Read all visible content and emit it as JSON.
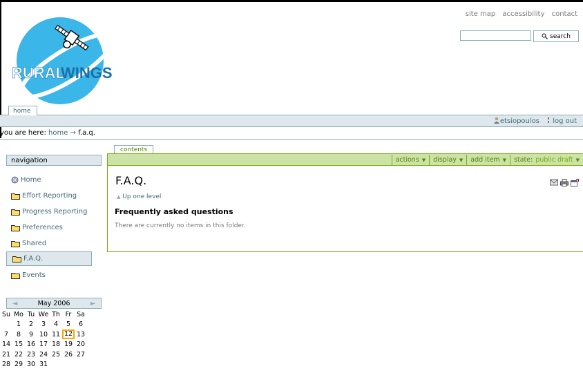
{
  "site_actions": [
    "site map",
    "accessibility",
    "contact"
  ],
  "search": {
    "value": "",
    "button_label": "search"
  },
  "logo": {
    "text_part1": "RURAL",
    "text_part2": "WINGS"
  },
  "tabs": {
    "home": "home"
  },
  "personal_bar": {
    "user": "etsiopoulos",
    "logout": "log out"
  },
  "breadcrumb": {
    "prefix": "you are here:",
    "home": "home",
    "arrow": "→",
    "current": "f.a.q."
  },
  "navigation": {
    "title": "navigation",
    "items": [
      {
        "label": "Home",
        "icon": "globe-icon"
      },
      {
        "label": "Effort Reporting",
        "icon": "folder-icon"
      },
      {
        "label": "Progress Reporting",
        "icon": "folder-icon"
      },
      {
        "label": "Preferences",
        "icon": "folder-icon"
      },
      {
        "label": "Shared",
        "icon": "folder-icon"
      },
      {
        "label": "F.A.Q.",
        "icon": "folder-icon",
        "selected": true
      },
      {
        "label": "Events",
        "icon": "folder-icon"
      }
    ]
  },
  "calendar": {
    "prev": "◄",
    "next": "►",
    "month": "May 2006",
    "weekdays": [
      "Su",
      "Mo",
      "Tu",
      "We",
      "Th",
      "Fr",
      "Sa"
    ],
    "weeks": [
      [
        "",
        "1",
        "2",
        "3",
        "4",
        "5",
        "6"
      ],
      [
        "7",
        "8",
        "9",
        "10",
        "11",
        "12",
        "13"
      ],
      [
        "14",
        "15",
        "16",
        "17",
        "18",
        "19",
        "20"
      ],
      [
        "21",
        "22",
        "23",
        "24",
        "25",
        "26",
        "27"
      ],
      [
        "28",
        "29",
        "30",
        "31",
        "",
        "",
        ""
      ]
    ],
    "today": "12"
  },
  "content": {
    "tab": "contents",
    "menus": {
      "actions": "actions",
      "display": "display",
      "add_item": "add item",
      "state_label": "state:",
      "state_value": "public draft"
    },
    "title": "F.A.Q.",
    "up_level": "Up one level",
    "subtitle": "Frequently asked questions",
    "empty_message": "There are currently no items in this folder."
  },
  "colors": {
    "link": "#436976",
    "nav_bg": "#dee7ec",
    "border": "#8cacbb",
    "green": "#74ae0b",
    "green_bg": "#cde2a7",
    "today": "#ffa500"
  }
}
